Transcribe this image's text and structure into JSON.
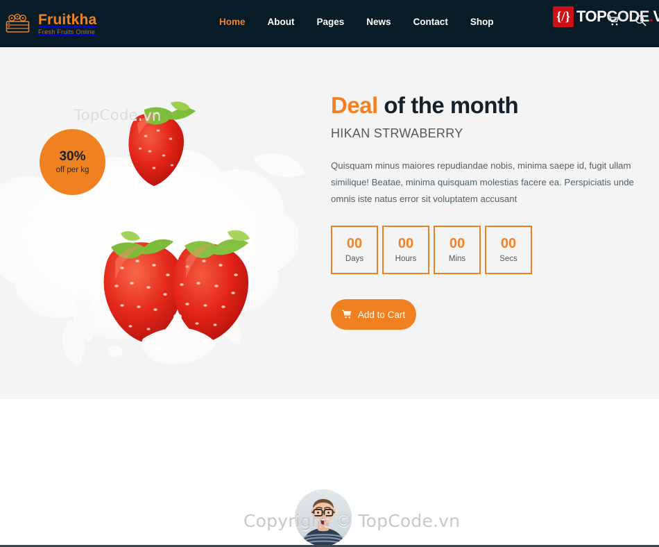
{
  "header": {
    "brand": {
      "icon": "fruit-basket-icon",
      "name": "Fruitkha",
      "tagline": "Fresh Fruits Online"
    },
    "nav": [
      {
        "label": "Home",
        "active": true
      },
      {
        "label": "About",
        "active": false
      },
      {
        "label": "Pages",
        "active": false
      },
      {
        "label": "News",
        "active": false
      },
      {
        "label": "Contact",
        "active": false
      },
      {
        "label": "Shop",
        "active": false
      }
    ],
    "tools": [
      {
        "icon": "cart-icon",
        "label": "Cart"
      },
      {
        "icon": "search-icon",
        "label": "Search"
      }
    ],
    "accent_color": "#f28123",
    "background_color": "#071c26"
  },
  "watermark": {
    "logo_bracket": "{/}",
    "logo_top": "TOP",
    "logo_code": "CODE",
    "logo_dot": ".",
    "logo_vn": "VN",
    "hero_text": "TopCode.vn",
    "bottom_text": "Copyright © TopCode.vn",
    "badge_color": "#cc1017"
  },
  "deal": {
    "badge": {
      "percent": "30%",
      "sub": "off per kg"
    },
    "title_highlight": "Deal",
    "title_rest": " of the month",
    "subtitle": "HIKAN STRWABERRY",
    "description": "Quisquam minus maiores repudiandae nobis, minima saepe id, fugit ullam similique! Beatae, minima quisquam molestias facere ea. Perspiciatis unde omnis iste natus error sit voluptatem accusant",
    "countdown": [
      {
        "value": "00",
        "label": "Days"
      },
      {
        "value": "00",
        "label": "Hours"
      },
      {
        "value": "00",
        "label": "Mins"
      },
      {
        "value": "00",
        "label": "Secs"
      }
    ],
    "cta": {
      "icon": "cart-icon",
      "label": "Add to Cart"
    },
    "image_alt": "strawberries-milk-splash",
    "accent_color": "#f28123",
    "background_color": "#f4f4f4"
  },
  "testimonial": {
    "avatar_alt": "person-with-glasses-avatar"
  }
}
